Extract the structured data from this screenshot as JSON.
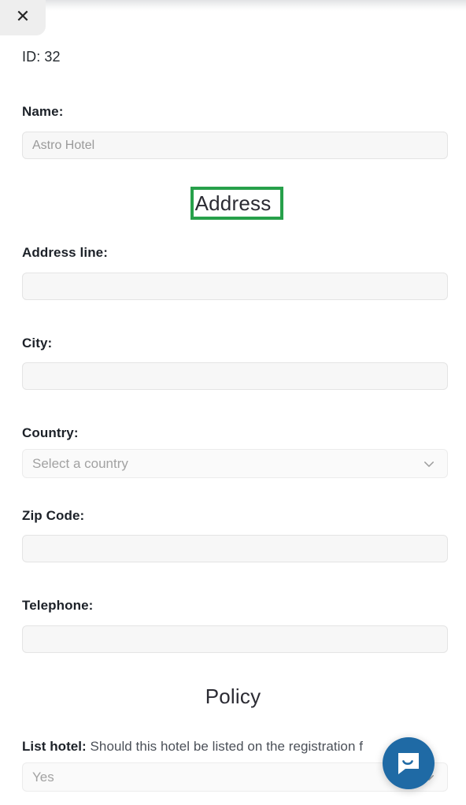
{
  "window": {
    "close_label": "✕"
  },
  "record": {
    "id_text": "ID: 32"
  },
  "form": {
    "name": {
      "label": "Name:",
      "value": "Astro Hotel"
    }
  },
  "sections": {
    "address": {
      "heading": "Address",
      "highlight_color": "#27a04a",
      "fields": {
        "address_line": {
          "label": "Address line:",
          "value": ""
        },
        "city": {
          "label": "City:",
          "value": ""
        },
        "country": {
          "label": "Country:",
          "placeholder": "Select a country",
          "value": ""
        },
        "zip": {
          "label": "Zip Code:",
          "value": ""
        },
        "telephone": {
          "label": "Telephone:",
          "value": ""
        }
      }
    },
    "policy": {
      "heading": "Policy",
      "list_hotel": {
        "label": "List hotel:",
        "description": "Should this hotel be listed on the registration f",
        "value": "Yes"
      }
    }
  },
  "widgets": {
    "intercom": {
      "icon": "chat-bubble-icon",
      "color": "#1f6aa5"
    }
  }
}
